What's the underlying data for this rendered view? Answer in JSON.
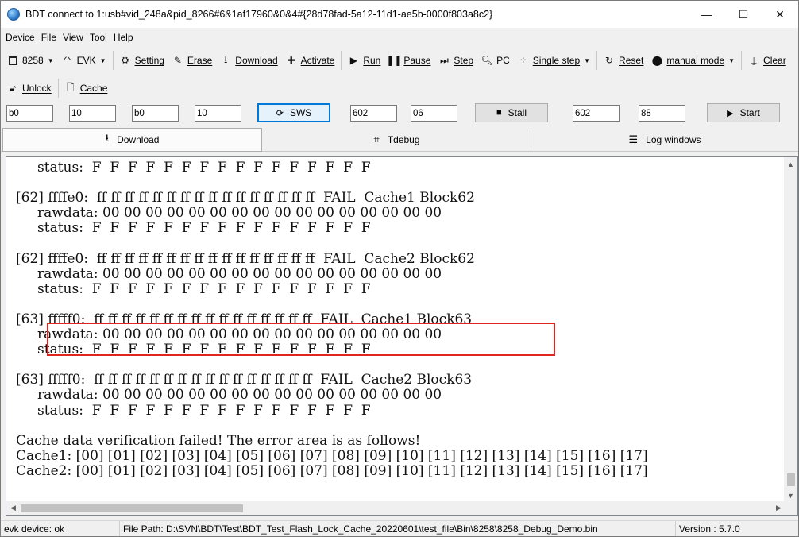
{
  "window": {
    "title": "BDT connect to 1:usb#vid_248a&pid_8266#6&1af17960&0&4#{28d78fad-5a12-11d1-ae5b-0000f803a8c2}",
    "icon": "app-globe-icon",
    "controls": {
      "minimize": "—",
      "maximize": "☐",
      "close": "✕"
    }
  },
  "menu": [
    "Device",
    "File",
    "View",
    "Tool",
    "Help"
  ],
  "toolbar1": {
    "chip": "8258",
    "board": "EVK",
    "setting": "Setting",
    "erase": "Erase",
    "download": "Download",
    "activate": "Activate",
    "run": "Run",
    "pause": "Pause",
    "step": "Step",
    "pc": "PC",
    "single_step": "Single step",
    "reset": "Reset",
    "manual_mode": "manual mode",
    "clear": "Clear"
  },
  "toolbar2": {
    "unlock": "Unlock",
    "cache": "Cache"
  },
  "inputs": {
    "addr1": "b0",
    "len1": "10",
    "addr2": "b0",
    "len2": "10",
    "sws_label": "SWS",
    "addr3": "602",
    "val3": "06",
    "stall_label": "Stall",
    "addr4": "602",
    "val4": "88",
    "start_label": "Start"
  },
  "tabs": {
    "download": "Download",
    "tdebug": "Tdebug",
    "log": "Log windows"
  },
  "output": {
    "lines": [
      "     status:  F  F  F  F  F  F  F  F  F  F  F  F  F  F  F  F",
      "",
      "[62] ffffe0:  ff ff ff ff ff ff ff ff ff ff ff ff ff ff ff ff  FAIL  Cache1 Block62",
      "     rawdata: 00 00 00 00 00 00 00 00 00 00 00 00 00 00 00 00",
      "     status:  F  F  F  F  F  F  F  F  F  F  F  F  F  F  F  F",
      "",
      "[62] ffffe0:  ff ff ff ff ff ff ff ff ff ff ff ff ff ff ff ff  FAIL  Cache2 Block62",
      "     rawdata: 00 00 00 00 00 00 00 00 00 00 00 00 00 00 00 00",
      "     status:  F  F  F  F  F  F  F  F  F  F  F  F  F  F  F  F",
      "",
      "[63] fffff0:  ff ff ff ff ff ff ff ff ff ff ff ff ff ff ff ff  FAIL  Cache1 Block63",
      "     rawdata: 00 00 00 00 00 00 00 00 00 00 00 00 00 00 00 00",
      "     status:  F  F  F  F  F  F  F  F  F  F  F  F  F  F  F  F",
      "",
      "[63] fffff0:  ff ff ff ff ff ff ff ff ff ff ff ff ff ff ff ff  FAIL  Cache2 Block63",
      "     rawdata: 00 00 00 00 00 00 00 00 00 00 00 00 00 00 00 00",
      "     status:  F  F  F  F  F  F  F  F  F  F  F  F  F  F  F  F",
      "",
      "Cache data verification failed! The error area is as follows!",
      "Cache1: [00] [01] [02] [03] [04] [05] [06] [07] [08] [09] [10] [11] [12] [13] [14] [15] [16] [17]",
      "Cache2: [00] [01] [02] [03] [04] [05] [06] [07] [08] [09] [10] [11] [12] [13] [14] [15] [16] [17]"
    ]
  },
  "status": {
    "device": "evk device: ok",
    "file_path": "File Path:  D:\\SVN\\BDT\\Test\\BDT_Test_Flash_Lock_Cache_20220601\\test_file\\Bin\\8258\\8258_Debug_Demo.bin",
    "version": "Version : 5.7.0"
  },
  "colors": {
    "highlight_box": "#e0241e",
    "focus_border": "#0078d7"
  }
}
